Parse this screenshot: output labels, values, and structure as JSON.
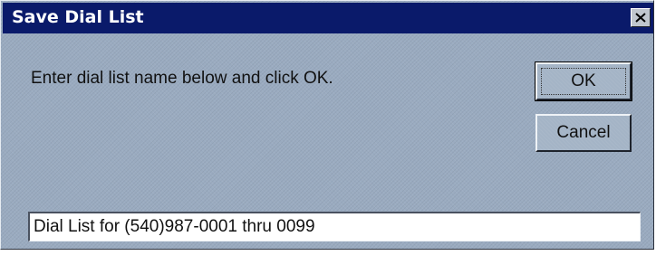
{
  "window": {
    "title": "Save Dial List",
    "close_icon": "close-x-icon"
  },
  "dialog": {
    "prompt": "Enter dial list name below and click OK.",
    "name_value": "Dial List for (540)987-0001 thru 0099"
  },
  "buttons": {
    "ok_label": "OK",
    "cancel_label": "Cancel"
  },
  "colors": {
    "titlebar": "#0a1a6a",
    "dialog_background": "#9aabc0"
  }
}
